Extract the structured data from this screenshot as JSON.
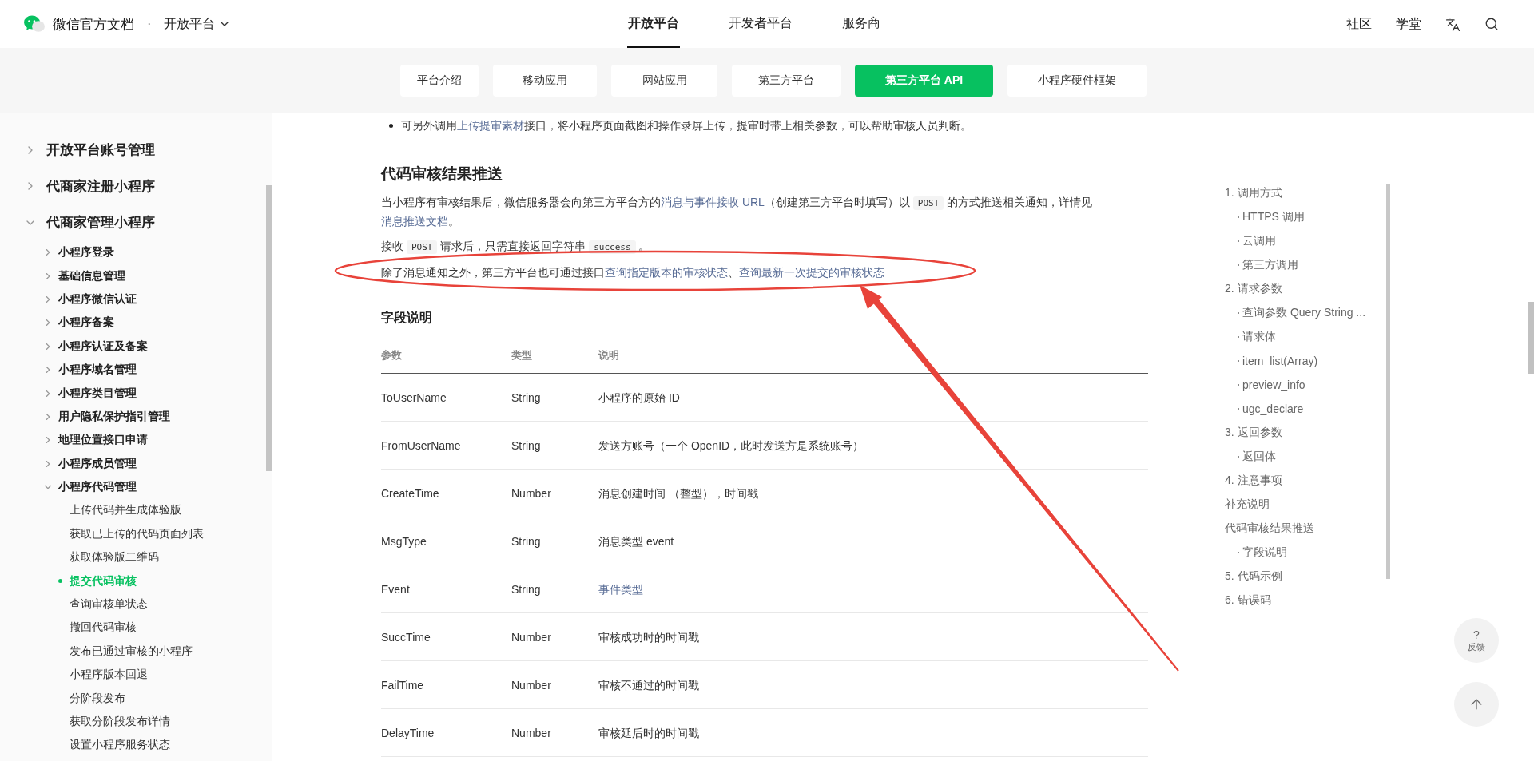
{
  "header": {
    "brand": "微信官方文档",
    "separator": "·",
    "section": "开放平台",
    "nav": [
      {
        "label": "开放平台",
        "selected": true
      },
      {
        "label": "开发者平台",
        "selected": false
      },
      {
        "label": "服务商",
        "selected": false
      }
    ],
    "links": [
      "社区",
      "学堂"
    ]
  },
  "subnav": [
    {
      "label": "平台介绍",
      "selected": false
    },
    {
      "label": "移动应用",
      "selected": false
    },
    {
      "label": "网站应用",
      "selected": false
    },
    {
      "label": "第三方平台",
      "selected": false
    },
    {
      "label": "第三方平台 API",
      "selected": true
    },
    {
      "label": "小程序硬件框架",
      "selected": false
    }
  ],
  "sidebar": {
    "items": [
      {
        "label": "开放平台账号管理",
        "expanded": false
      },
      {
        "label": "代商家注册小程序",
        "expanded": false
      },
      {
        "label": "代商家管理小程序",
        "expanded": true,
        "children": [
          {
            "label": "小程序登录",
            "expanded": false
          },
          {
            "label": "基础信息管理",
            "expanded": false
          },
          {
            "label": "小程序微信认证",
            "expanded": false
          },
          {
            "label": "小程序备案",
            "expanded": false
          },
          {
            "label": "小程序认证及备案",
            "expanded": false
          },
          {
            "label": "小程序域名管理",
            "expanded": false
          },
          {
            "label": "小程序类目管理",
            "expanded": false
          },
          {
            "label": "用户隐私保护指引管理",
            "expanded": false
          },
          {
            "label": "地理位置接口申请",
            "expanded": false
          },
          {
            "label": "小程序成员管理",
            "expanded": false
          },
          {
            "label": "小程序代码管理",
            "expanded": true,
            "children": [
              {
                "label": "上传代码并生成体验版",
                "selected": false
              },
              {
                "label": "获取已上传的代码页面列表",
                "selected": false
              },
              {
                "label": "获取体验版二维码",
                "selected": false
              },
              {
                "label": "提交代码审核",
                "selected": true
              },
              {
                "label": "查询审核单状态",
                "selected": false
              },
              {
                "label": "撤回代码审核",
                "selected": false
              },
              {
                "label": "发布已通过审核的小程序",
                "selected": false
              },
              {
                "label": "小程序版本回退",
                "selected": false
              },
              {
                "label": "分阶段发布",
                "selected": false
              },
              {
                "label": "获取分阶段发布详情",
                "selected": false
              },
              {
                "label": "设置小程序服务状态",
                "selected": false
              }
            ]
          }
        ]
      }
    ]
  },
  "content": [
    {
      "kind": "bullet",
      "parts": [
        {
          "kind": "text",
          "text": "可另外调用"
        },
        {
          "kind": "link",
          "text": "上传提审素材"
        },
        {
          "kind": "text",
          "text": "接口，将小程序页面截图和操作录屏上传，提审时带上相关参数，可以帮助审核人员判断。"
        }
      ]
    },
    {
      "kind": "heading",
      "text": "代码审核结果推送"
    },
    {
      "kind": "paragraph",
      "parts": [
        {
          "kind": "text",
          "text": "当小程序有审核结果后，微信服务器会向第三方平台方的"
        },
        {
          "kind": "link",
          "text": "消息与事件接收 URL"
        },
        {
          "kind": "text",
          "text": "（创建第三方平台时填写）以 "
        },
        {
          "kind": "code",
          "text": "POST"
        },
        {
          "kind": "text",
          "text": " 的方式推送相关通知，详情见"
        },
        {
          "kind": "link",
          "text": "消息推送文档"
        },
        {
          "kind": "text",
          "text": "。"
        }
      ]
    },
    {
      "kind": "paragraph",
      "parts": [
        {
          "kind": "text",
          "text": "接收 "
        },
        {
          "kind": "code",
          "text": "POST"
        },
        {
          "kind": "text",
          "text": " 请求后，只需直接返回字符串 "
        },
        {
          "kind": "code",
          "text": "success"
        },
        {
          "kind": "text",
          "text": " 。"
        }
      ]
    },
    {
      "kind": "paragraph",
      "parts": [
        {
          "kind": "text",
          "text": "除了消息通知之外，第三方平台也可通过接口"
        },
        {
          "kind": "link",
          "text": "查询指定版本的审核状态"
        },
        {
          "kind": "text",
          "text": "、"
        },
        {
          "kind": "link",
          "text": "查询最新一次提交的审核状态"
        }
      ]
    },
    {
      "kind": "subheading",
      "text": "字段说明"
    }
  ],
  "table": {
    "columns": [
      "参数",
      "类型",
      "说明"
    ],
    "rows": [
      [
        {
          "text": "ToUserName"
        },
        {
          "text": "String"
        },
        {
          "text": "小程序的原始 ID"
        }
      ],
      [
        {
          "text": "FromUserName"
        },
        {
          "text": "String"
        },
        {
          "text": "发送方账号（一个 OpenID，此时发送方是系统账号）"
        }
      ],
      [
        {
          "text": "CreateTime"
        },
        {
          "text": "Number"
        },
        {
          "text": "消息创建时间 （整型），时间戳"
        }
      ],
      [
        {
          "text": "MsgType"
        },
        {
          "text": "String"
        },
        {
          "text": "消息类型 event"
        }
      ],
      [
        {
          "text": "Event"
        },
        {
          "text": "String"
        },
        {
          "text": "事件类型",
          "kind": "link"
        }
      ],
      [
        {
          "text": "SuccTime"
        },
        {
          "text": "Number"
        },
        {
          "text": "审核成功时的时间戳"
        }
      ],
      [
        {
          "text": "FailTime"
        },
        {
          "text": "Number"
        },
        {
          "text": "审核不通过的时间戳"
        }
      ],
      [
        {
          "text": "DelayTime"
        },
        {
          "text": "Number"
        },
        {
          "text": "审核延后时的时间戳"
        }
      ]
    ]
  },
  "toc": [
    {
      "label": "1. 调用方式",
      "children": [
        {
          "label": "HTTPS 调用"
        },
        {
          "label": "云调用"
        },
        {
          "label": "第三方调用"
        }
      ]
    },
    {
      "label": "2. 请求参数",
      "children": [
        {
          "label": "查询参数 Query String ..."
        },
        {
          "label": "请求体"
        },
        {
          "label": "item_list(Array)"
        },
        {
          "label": "preview_info"
        },
        {
          "label": "ugc_declare"
        }
      ]
    },
    {
      "label": "3. 返回参数",
      "children": [
        {
          "label": "返回体"
        }
      ]
    },
    {
      "label": "4. 注意事项"
    },
    {
      "label": "补充说明"
    },
    {
      "label": "代码审核结果推送",
      "children": [
        {
          "label": "字段说明"
        }
      ]
    },
    {
      "label": "5. 代码示例"
    },
    {
      "label": "6. 错误码"
    }
  ],
  "float_buttons": [
    {
      "kind": "feedback",
      "icon": "?",
      "label": "反馈"
    },
    {
      "kind": "top"
    }
  ]
}
